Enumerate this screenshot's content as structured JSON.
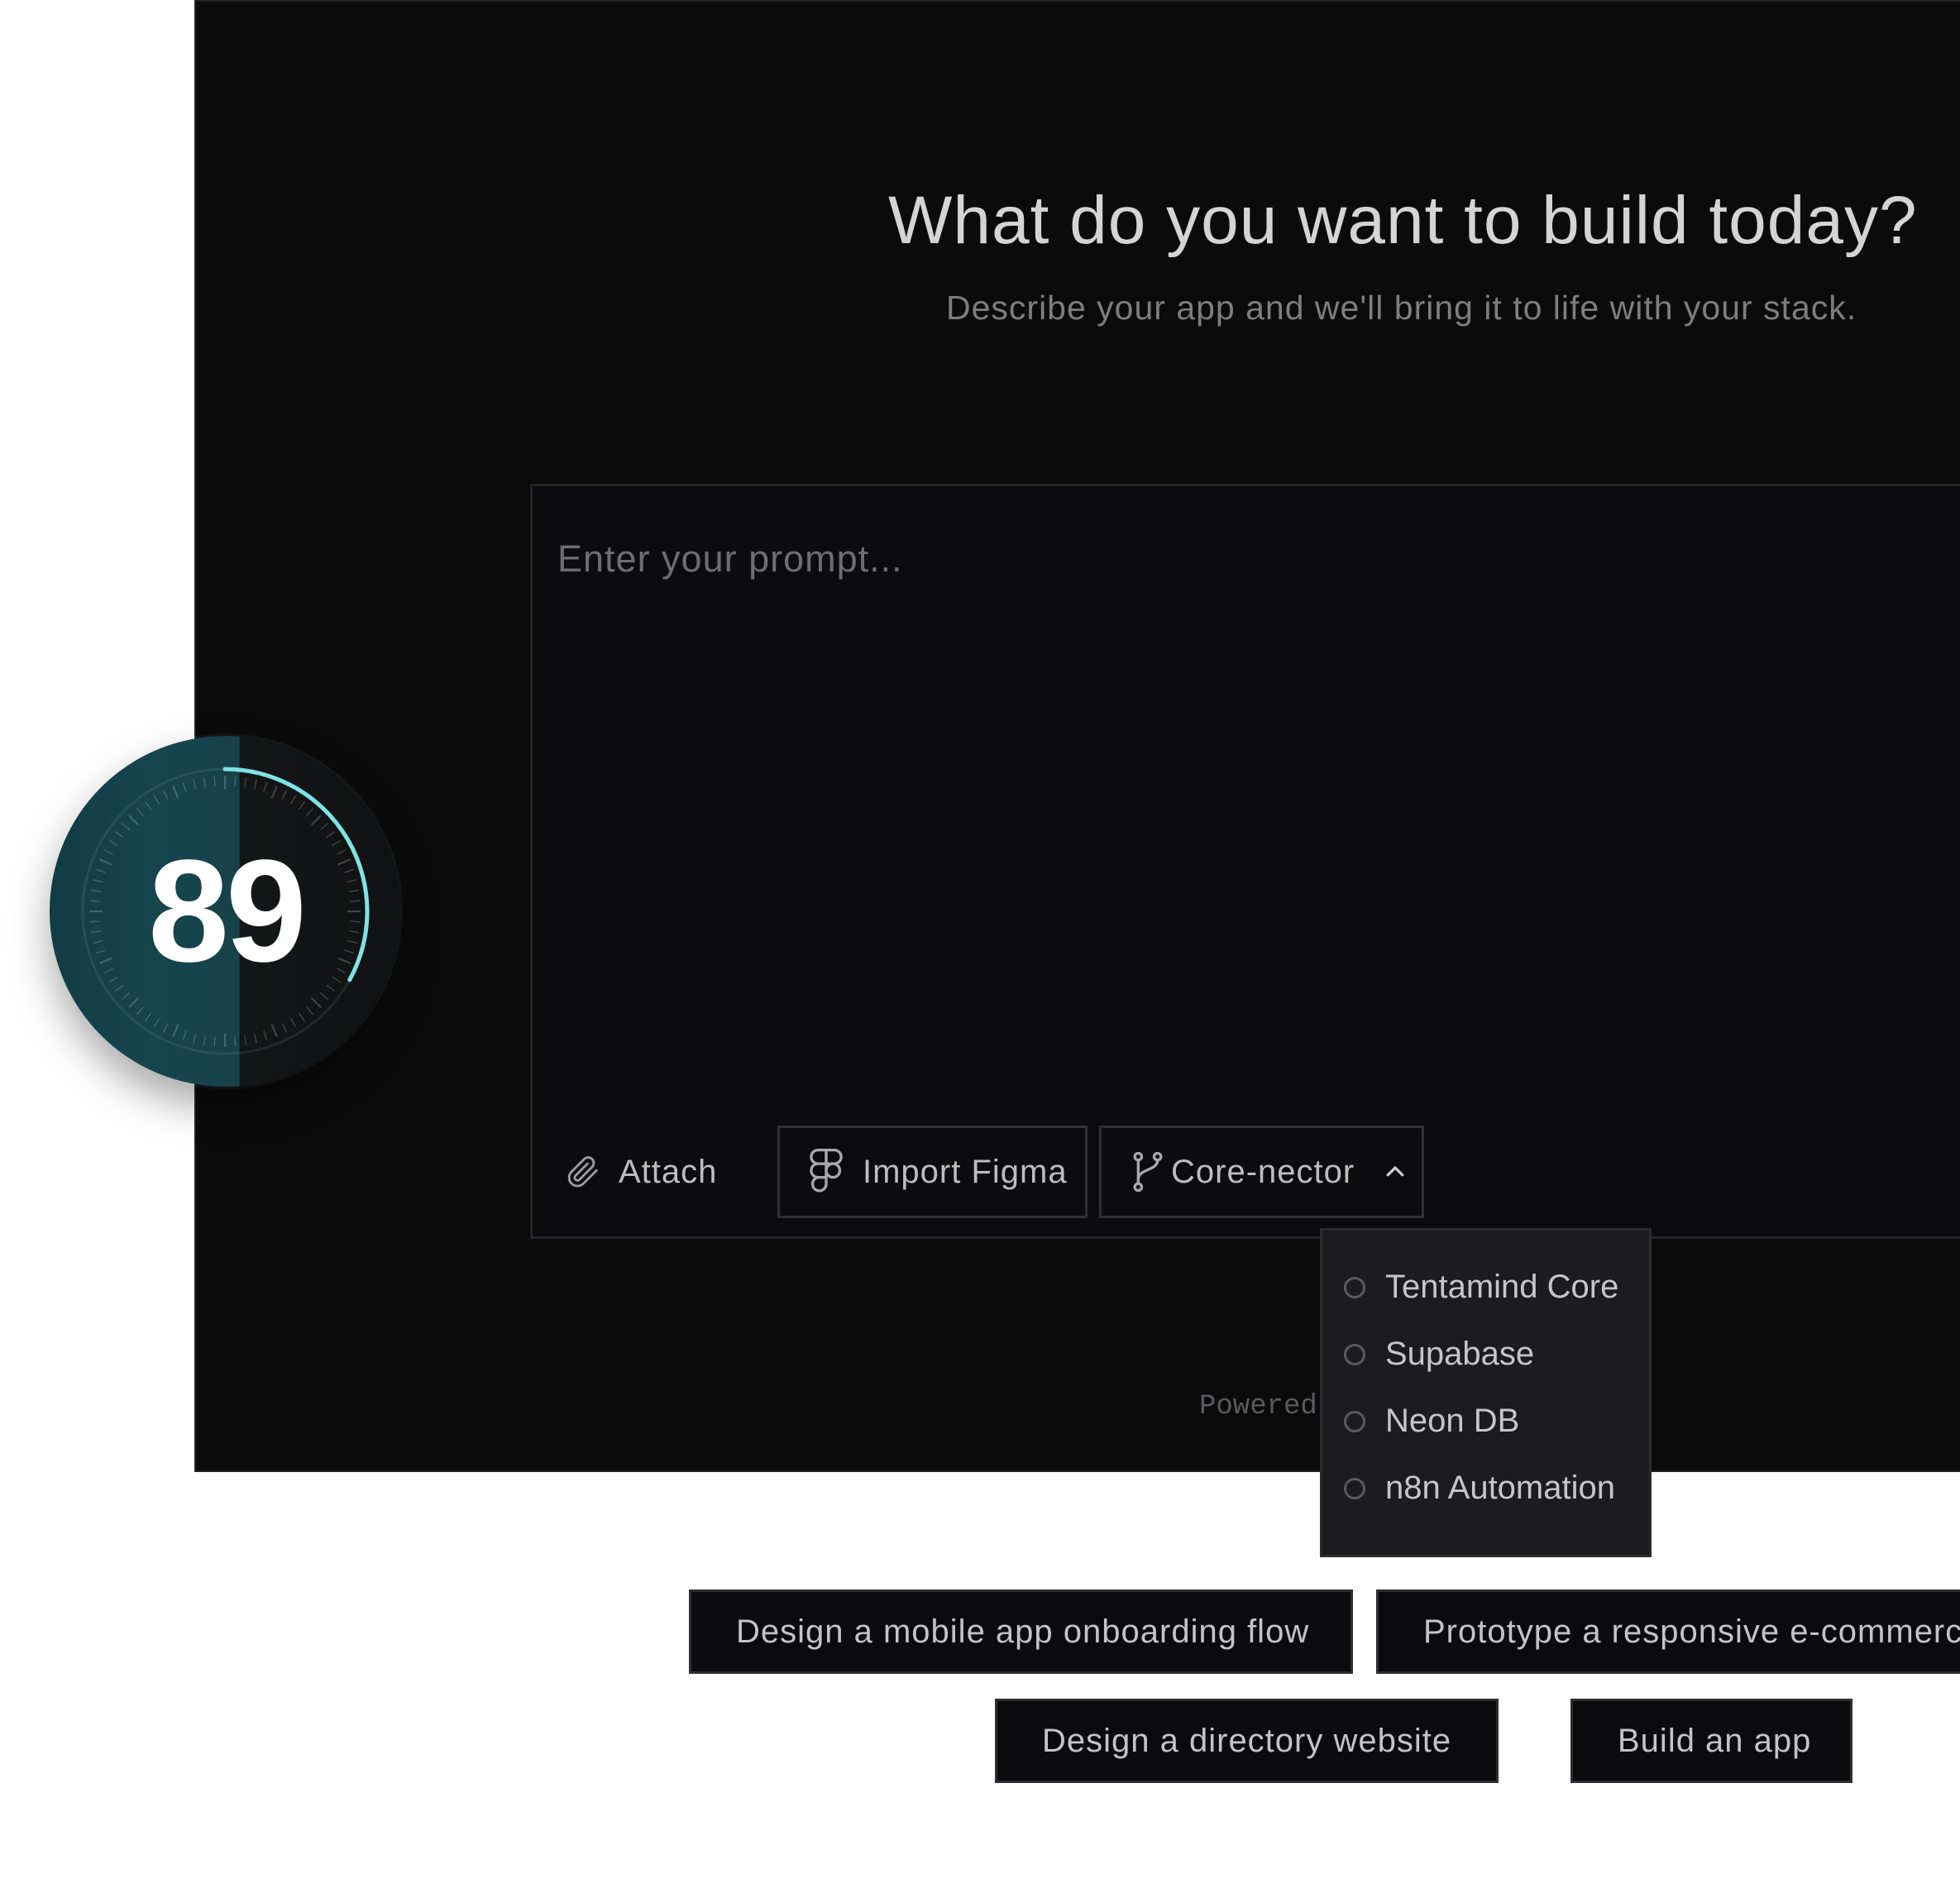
{
  "hero": {
    "title": "What do you want to build today?",
    "subtitle": "Describe your app and we'll bring it to life with your stack."
  },
  "prompt": {
    "placeholder": "Enter your prompt...",
    "value": ""
  },
  "toolbar": {
    "attach_label": "Attach",
    "attach_icon": "paperclip-icon",
    "figma_label": "Import Figma",
    "figma_icon": "figma-icon",
    "connector_label": "Core-nector",
    "connector_icon": "git-branch-icon",
    "connector_chevron": "chevron-up-icon"
  },
  "connector_menu": {
    "items": [
      {
        "label": "Tentamind Core"
      },
      {
        "label": "Supabase"
      },
      {
        "label": "Neon DB"
      },
      {
        "label": "n8n Automation"
      }
    ]
  },
  "footer": {
    "powered_text": "Powered"
  },
  "suggestions": [
    {
      "label": "Design a mobile app onboarding flow"
    },
    {
      "label": "Prototype a responsive e-commerce"
    },
    {
      "label": "Design a directory website"
    },
    {
      "label": "Build an app"
    }
  ],
  "score": {
    "value": "89",
    "progress": 0.33,
    "accent_color": "#7fe3e6"
  }
}
